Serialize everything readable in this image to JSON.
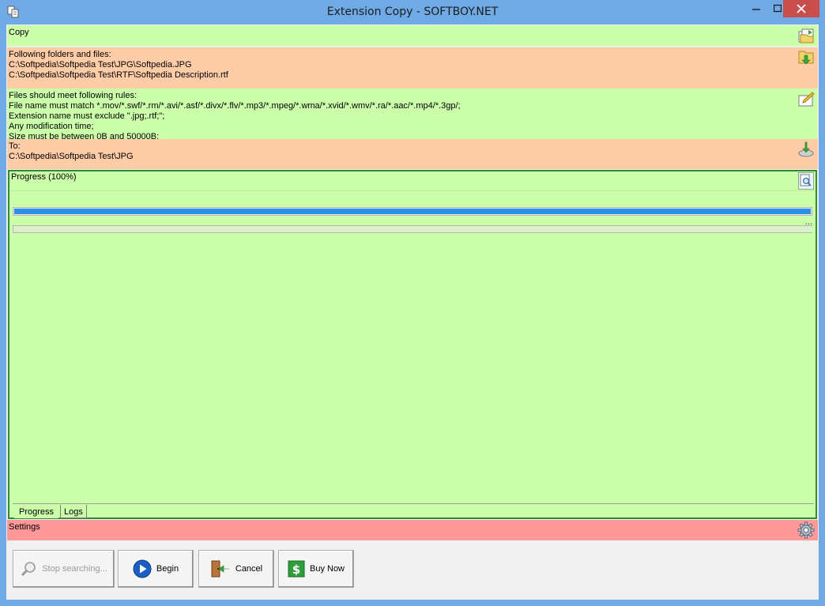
{
  "window": {
    "title": "Extension Copy  - SOFTBOY.NET"
  },
  "panels": {
    "copy": {
      "label": "Copy",
      "icon": "copy-folder-icon"
    },
    "files": {
      "heading": "Following folders and files:",
      "items": [
        "C:\\Softpedia\\Softpedia Test\\JPG\\Softpedia.JPG",
        "C:\\Softpedia\\Softpedia Test\\RTF\\Softpedia Description.rtf"
      ],
      "icon": "add-files-icon"
    },
    "rules": {
      "heading": "Files should meet following rules:",
      "lines": [
        "File name must match *.mov/*.swf/*.rm/*.avi/*.asf/*.divx/*.flv/*.mp3/*.mpeg/*.wma/*.xvid/*.wmv/*.ra/*.aac/*.mp4/*.3gp/;",
        "Extension name must exclude \".jpg;.rtf;\";",
        "Any modification time;",
        "Size must be between 0B and 50000B;"
      ],
      "icon": "edit-rules-icon"
    },
    "to": {
      "heading": "To:",
      "path": "C:\\Softpedia\\Softpedia Test\\JPG",
      "icon": "destination-icon"
    },
    "progress": {
      "title": "Progress (100%)",
      "percent": 100,
      "ellipsis": "...",
      "tabs": [
        "Progress",
        "Logs"
      ]
    },
    "settings": {
      "label": "Settings",
      "icon": "gear-icon"
    }
  },
  "buttons": {
    "stop": "Stop searching...",
    "begin": "Begin",
    "cancel": "Cancel",
    "buy": "Buy Now"
  },
  "colors": {
    "green_panel": "#ccffaa",
    "orange_panel": "#ffcca8",
    "red_panel": "#ff9999",
    "progress_fill": "#2e8fe6",
    "titlebar": "#6fa9e6"
  }
}
